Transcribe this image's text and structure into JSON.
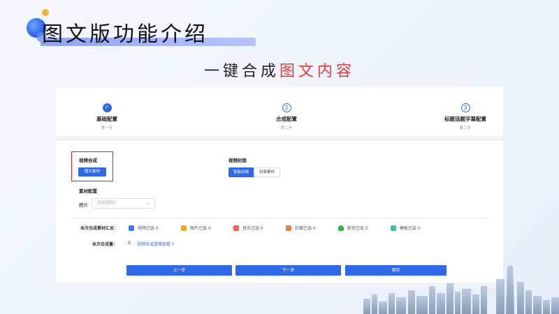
{
  "slide": {
    "title": "图文版功能介绍",
    "subtitle_black": "一键合成",
    "subtitle_red": "图文内容"
  },
  "steps": [
    {
      "label": "基础配置",
      "desc": "第一步",
      "state": "done",
      "num": "✓"
    },
    {
      "label": "合成配置",
      "desc": "第二步",
      "state": "todo",
      "num": "2"
    },
    {
      "label": "标题话题字幕配置",
      "desc": "第三步",
      "state": "todo",
      "num": "3"
    }
  ],
  "video_compose": {
    "label": "视频合成",
    "button": "图文素材"
  },
  "video_cover": {
    "label": "视频封面",
    "tabs": [
      "智能封面",
      "封面素材"
    ]
  },
  "material": {
    "label": "素材配置",
    "image_label": "图片",
    "image_placeholder": "请选择图片"
  },
  "summary": {
    "label": "本次合成素材汇总：",
    "items": [
      {
        "text": "视频已选 0",
        "icon": "video-icon",
        "color": "#3b7cf0"
      },
      {
        "text": "图片已选 0",
        "icon": "image-icon",
        "color": "#f5a623"
      },
      {
        "text": "音乐已选 0",
        "icon": "music-icon",
        "color": "#f0605c"
      },
      {
        "text": "封面已选 0",
        "icon": "cover-icon",
        "color": "#f07a3c"
      },
      {
        "text": "配音已选 0",
        "icon": "microphone-icon",
        "color": "#2fb24a"
      },
      {
        "text": "模板已选 0",
        "icon": "template-icon",
        "color": "#3dc2a8"
      }
    ],
    "amount_label": "本次合成量：",
    "amount_value": "0",
    "link": "视频合成逻辑查看 》"
  },
  "buttons": {
    "prev": "上一步",
    "next": "下一步",
    "save": "保存"
  },
  "colors": {
    "primary": "#2f6ae6",
    "highlight_red": "#e93a3a"
  }
}
